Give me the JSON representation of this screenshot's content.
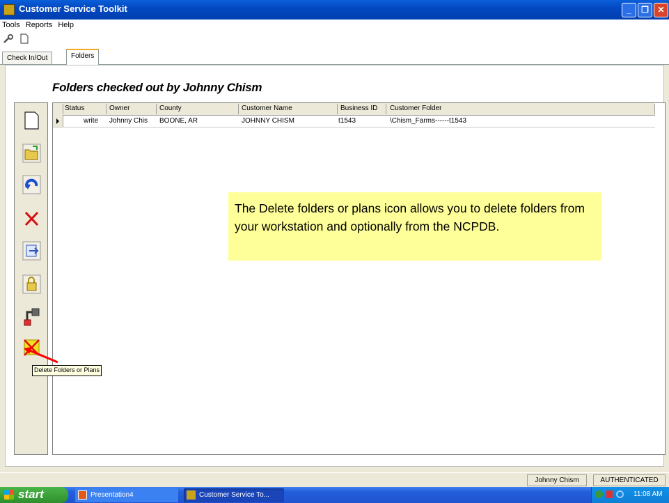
{
  "window": {
    "title": "Customer Service Toolkit",
    "minimize_glyph": "_",
    "maximize_glyph": "❐",
    "close_glyph": "✕"
  },
  "menu": {
    "items": [
      "Tools",
      "Reports",
      "Help"
    ]
  },
  "toolbar": {
    "icons": [
      "wrench-icon",
      "new-document-icon"
    ]
  },
  "tabs": [
    {
      "label": "Check In/Out",
      "active": false
    },
    {
      "label": "Folders",
      "active": true
    }
  ],
  "page": {
    "heading": "Folders checked out by Johnny Chism"
  },
  "left_toolbar": {
    "icons": [
      "new-folder-icon",
      "open-folder-icon",
      "refresh-icon",
      "delete-icon",
      "checkin-icon",
      "lock-icon",
      "transfer-icon",
      "delete-folders-or-plans-icon"
    ]
  },
  "grid": {
    "columns": [
      "Status",
      "Owner",
      "County",
      "Customer Name",
      "Business ID",
      "Customer Folder"
    ],
    "rows": [
      {
        "status": "write",
        "owner": "Johnny Chis",
        "county": "BOONE, AR",
        "customer_name": "JOHNNY CHISM",
        "business_id": "t1543",
        "customer_folder": "\\Chism_Farms------t1543"
      }
    ]
  },
  "callout": {
    "text": "The Delete folders or plans icon allows you to delete folders from your workstation and optionally from the NCPDB."
  },
  "tooltip": {
    "text": "Delete Folders or Plans"
  },
  "status": {
    "user": "Johnny Chism",
    "auth": "AUTHENTICATED"
  },
  "taskbar": {
    "start": "start",
    "buttons": [
      "Presentation4",
      "Customer Service To..."
    ],
    "clock": "11:08 AM"
  },
  "colors": {
    "callout_bg": "#ffff99",
    "title_bar": "#0a5fd8",
    "arrow": "#ff0000"
  }
}
